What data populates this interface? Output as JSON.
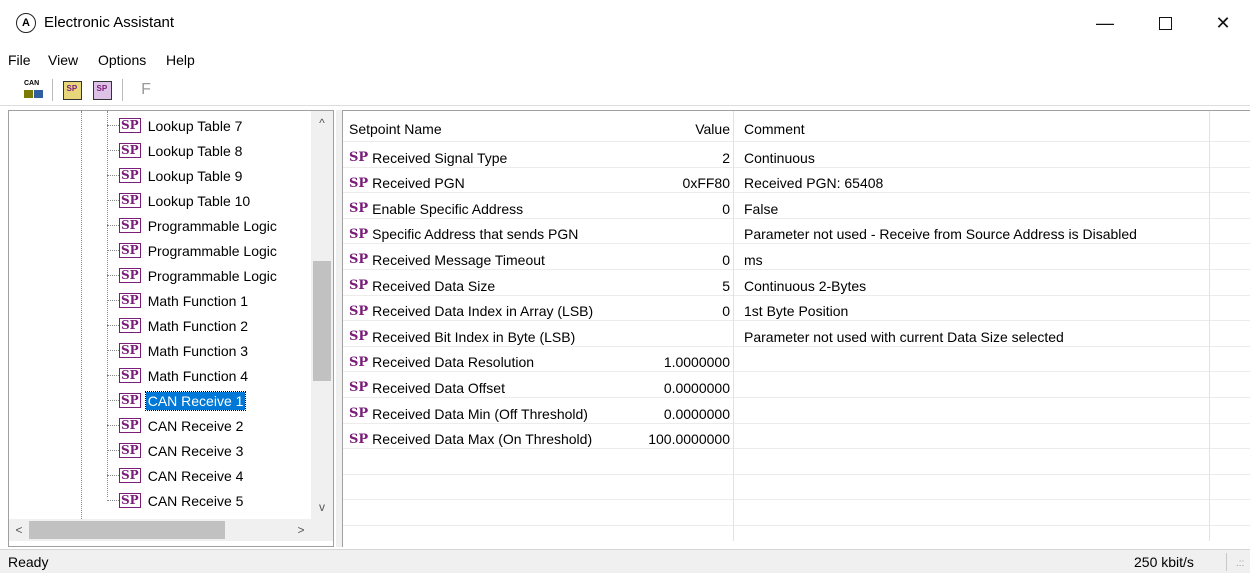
{
  "window": {
    "title": "Electronic Assistant",
    "icon": "app-logo-icon",
    "controls": {
      "minimize": "—",
      "maximize": "☐",
      "close": "✕"
    }
  },
  "menu": [
    "File",
    "View",
    "Options",
    "Help"
  ],
  "toolbar": {
    "can_label": "CAN",
    "sp_label": "SP",
    "f_label": "F"
  },
  "tree": {
    "badge": "SP",
    "items": [
      {
        "label": "Lookup Table 7"
      },
      {
        "label": "Lookup Table 8"
      },
      {
        "label": "Lookup Table 9"
      },
      {
        "label": "Lookup Table 10"
      },
      {
        "label": "Programmable Logic"
      },
      {
        "label": "Programmable Logic"
      },
      {
        "label": "Programmable Logic"
      },
      {
        "label": "Math Function 1"
      },
      {
        "label": "Math Function 2"
      },
      {
        "label": "Math Function 3"
      },
      {
        "label": "Math Function 4"
      },
      {
        "label": "CAN Receive 1",
        "selected": true
      },
      {
        "label": "CAN Receive 2"
      },
      {
        "label": "CAN Receive 3"
      },
      {
        "label": "CAN Receive 4"
      },
      {
        "label": "CAN Receive 5"
      }
    ],
    "scroll": {
      "up": "^",
      "down": "v",
      "left": "<",
      "right": ">"
    }
  },
  "grid": {
    "headers": {
      "name": "Setpoint Name",
      "value": "Value",
      "comment": "Comment"
    },
    "badge": "SP",
    "rows": [
      {
        "name": "Received Signal Type",
        "value": "2",
        "comment": "Continuous"
      },
      {
        "name": "Received PGN",
        "value": "0xFF80",
        "comment": "Received PGN: 65408"
      },
      {
        "name": "Enable Specific Address",
        "value": "0",
        "comment": "False"
      },
      {
        "name": "Specific Address that sends PGN",
        "value": "",
        "comment": "Parameter not used - Receive from Source Address is Disabled"
      },
      {
        "name": "Received Message Timeout",
        "value": "0",
        "comment": "ms"
      },
      {
        "name": "Received Data Size",
        "value": "5",
        "comment": "Continuous 2-Bytes"
      },
      {
        "name": "Received Data Index in Array (LSB)",
        "value": "0",
        "comment": "1st Byte Position"
      },
      {
        "name": "Received Bit Index in Byte (LSB)",
        "value": "",
        "comment": "Parameter not used with current Data Size selected"
      },
      {
        "name": "Received Data Resolution",
        "value": "1.0000000",
        "comment": ""
      },
      {
        "name": "Received Data Offset",
        "value": "0.0000000",
        "comment": ""
      },
      {
        "name": "Received Data Min (Off Threshold)",
        "value": "0.0000000",
        "comment": ""
      },
      {
        "name": "Received Data Max (On Threshold)",
        "value": "100.0000000",
        "comment": ""
      }
    ]
  },
  "status": {
    "left": "Ready",
    "right": "250 kbit/s",
    "grip": ".::"
  }
}
